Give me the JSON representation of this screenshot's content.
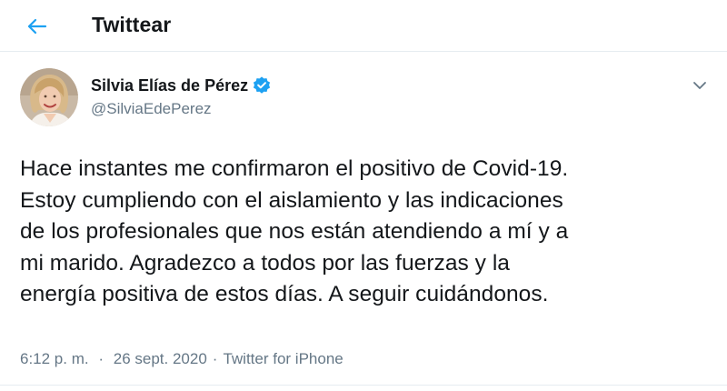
{
  "header": {
    "back_icon": "arrow-left-icon",
    "title": "Twittear"
  },
  "author": {
    "avatar_icon": "profile-photo",
    "name": "Silvia Elías de Pérez",
    "verified_icon": "verified-badge-icon",
    "handle": "@SilviaEdePerez",
    "more_icon": "chevron-down-icon"
  },
  "tweet": {
    "lines": [
      "Hace instantes me confirmaron el positivo de Covid-19.",
      "Estoy cumpliendo con el aislamiento y las indicaciones",
      "de los profesionales que nos están atendiendo a mí y a",
      "mi marido. Agradezco a todos por las fuerzas y la",
      "energía positiva de estos días. A seguir cuidándonos."
    ]
  },
  "meta": {
    "time": "6:12 p. m.",
    "separator": "·",
    "date": "26 sept. 2020",
    "source": "Twitter for iPhone"
  },
  "colors": {
    "accent": "#1da1f2",
    "text": "#14171a",
    "secondary": "#657786",
    "divider": "#e6ecf0"
  }
}
